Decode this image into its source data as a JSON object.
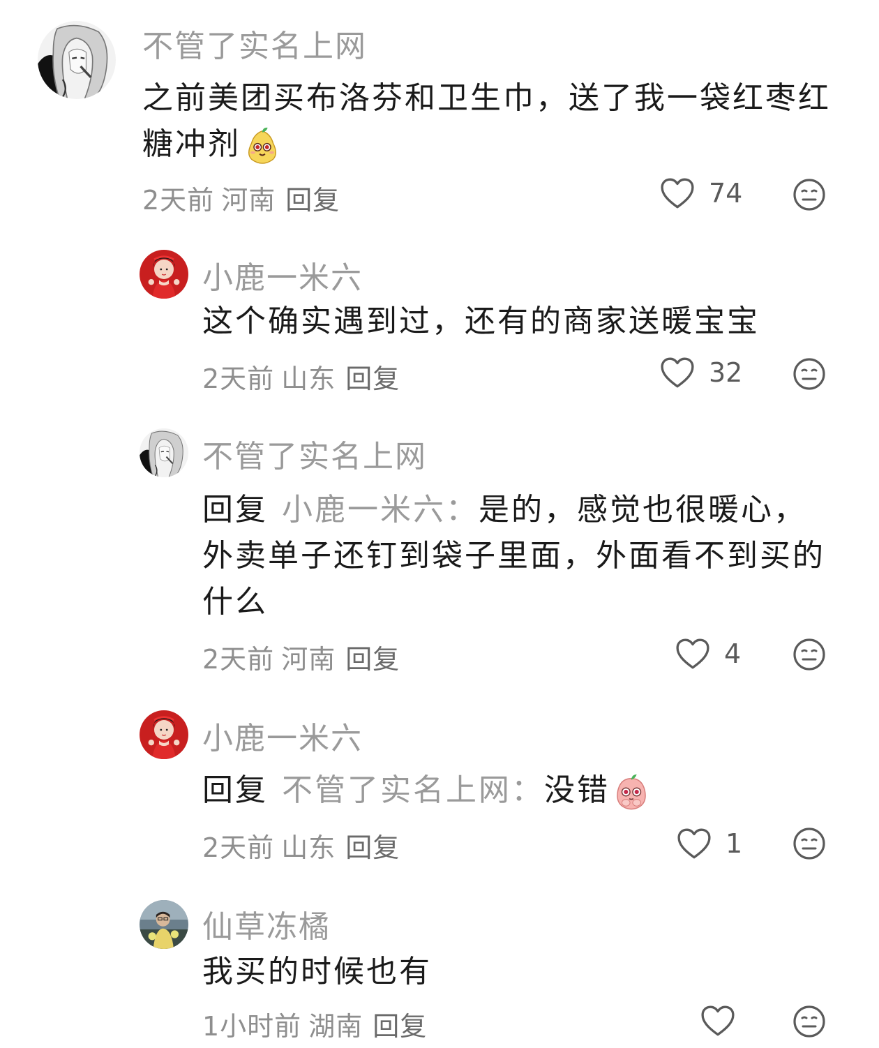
{
  "comments": [
    {
      "username": "不管了实名上网",
      "text": "之前美团买布洛芬和卫生巾，送了我一袋红枣红糖冲剂",
      "emoji": "pear-face-emoji",
      "time": "2天前",
      "location": "河南",
      "reply_label": "回复",
      "likes": "74",
      "avatar": "manga-girl-avatar"
    },
    {
      "username": "小鹿一米六",
      "text": "这个确实遇到过，还有的商家送暖宝宝",
      "time": "2天前",
      "location": "山东",
      "reply_label": "回复",
      "likes": "32",
      "avatar": "red-dress-girl-avatar"
    },
    {
      "username": "不管了实名上网",
      "reply_prefix": "回复",
      "reply_target": "小鹿一米六：",
      "text": "是的，感觉也很暖心，外卖单子还钉到袋子里面，外面看不到买的什么",
      "time": "2天前",
      "location": "河南",
      "reply_label": "回复",
      "likes": "4",
      "avatar": "manga-girl-avatar"
    },
    {
      "username": "小鹿一米六",
      "reply_prefix": "回复",
      "reply_target": "不管了实名上网：",
      "text": "没错",
      "emoji": "pleading-peach-emoji",
      "time": "2天前",
      "location": "山东",
      "reply_label": "回复",
      "likes": "1",
      "avatar": "red-dress-girl-avatar"
    },
    {
      "username": "仙草冻橘",
      "text": "我买的时候也有",
      "time": "1小时前",
      "location": "湖南",
      "reply_label": "回复",
      "likes": "",
      "avatar": "photo-avatar"
    }
  ],
  "colors": {
    "username": "#9a9a9a",
    "text": "#1a1a1a",
    "meta": "#8e8e8e",
    "icon": "#5a5a5a"
  }
}
